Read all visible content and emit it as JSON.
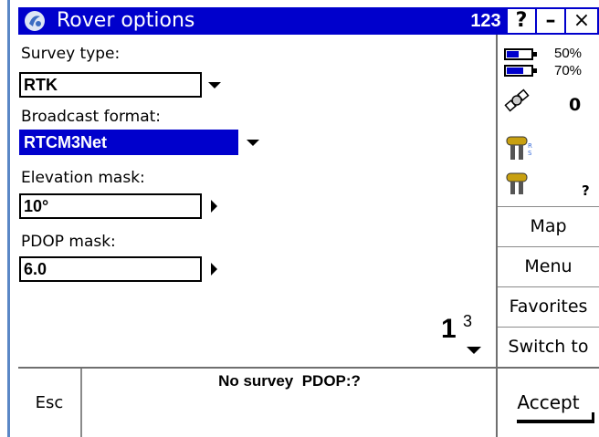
{
  "titlebar": {
    "title": "Rover options",
    "input_mode": "123",
    "help": "?",
    "minimize": "–",
    "close": "×"
  },
  "form": {
    "survey_type_label": "Survey type:",
    "survey_type_value": "RTK",
    "broadcast_label": "Broadcast format:",
    "broadcast_value": "RTCM3Net",
    "elev_label": "Elevation mask:",
    "elev_value": "10°",
    "pdop_label": "PDOP mask:",
    "pdop_value": "6.0"
  },
  "page_indicator": {
    "current": "1",
    "total": "3"
  },
  "status_panel": {
    "battery1_pct": "50%",
    "battery1_level": 0.5,
    "battery2_pct": "70%",
    "battery2_level": 0.7,
    "satellites": "0",
    "rover_marker": "?"
  },
  "side_buttons": {
    "map": "Map",
    "menu": "Menu",
    "favorites": "Favorites",
    "switch_to": "Switch to"
  },
  "bottom": {
    "esc": "Esc",
    "status": "No survey  PDOP:?",
    "accept": "Accept"
  },
  "colors": {
    "titlebar": "#0000cc",
    "selected_field": "#0000cc"
  }
}
